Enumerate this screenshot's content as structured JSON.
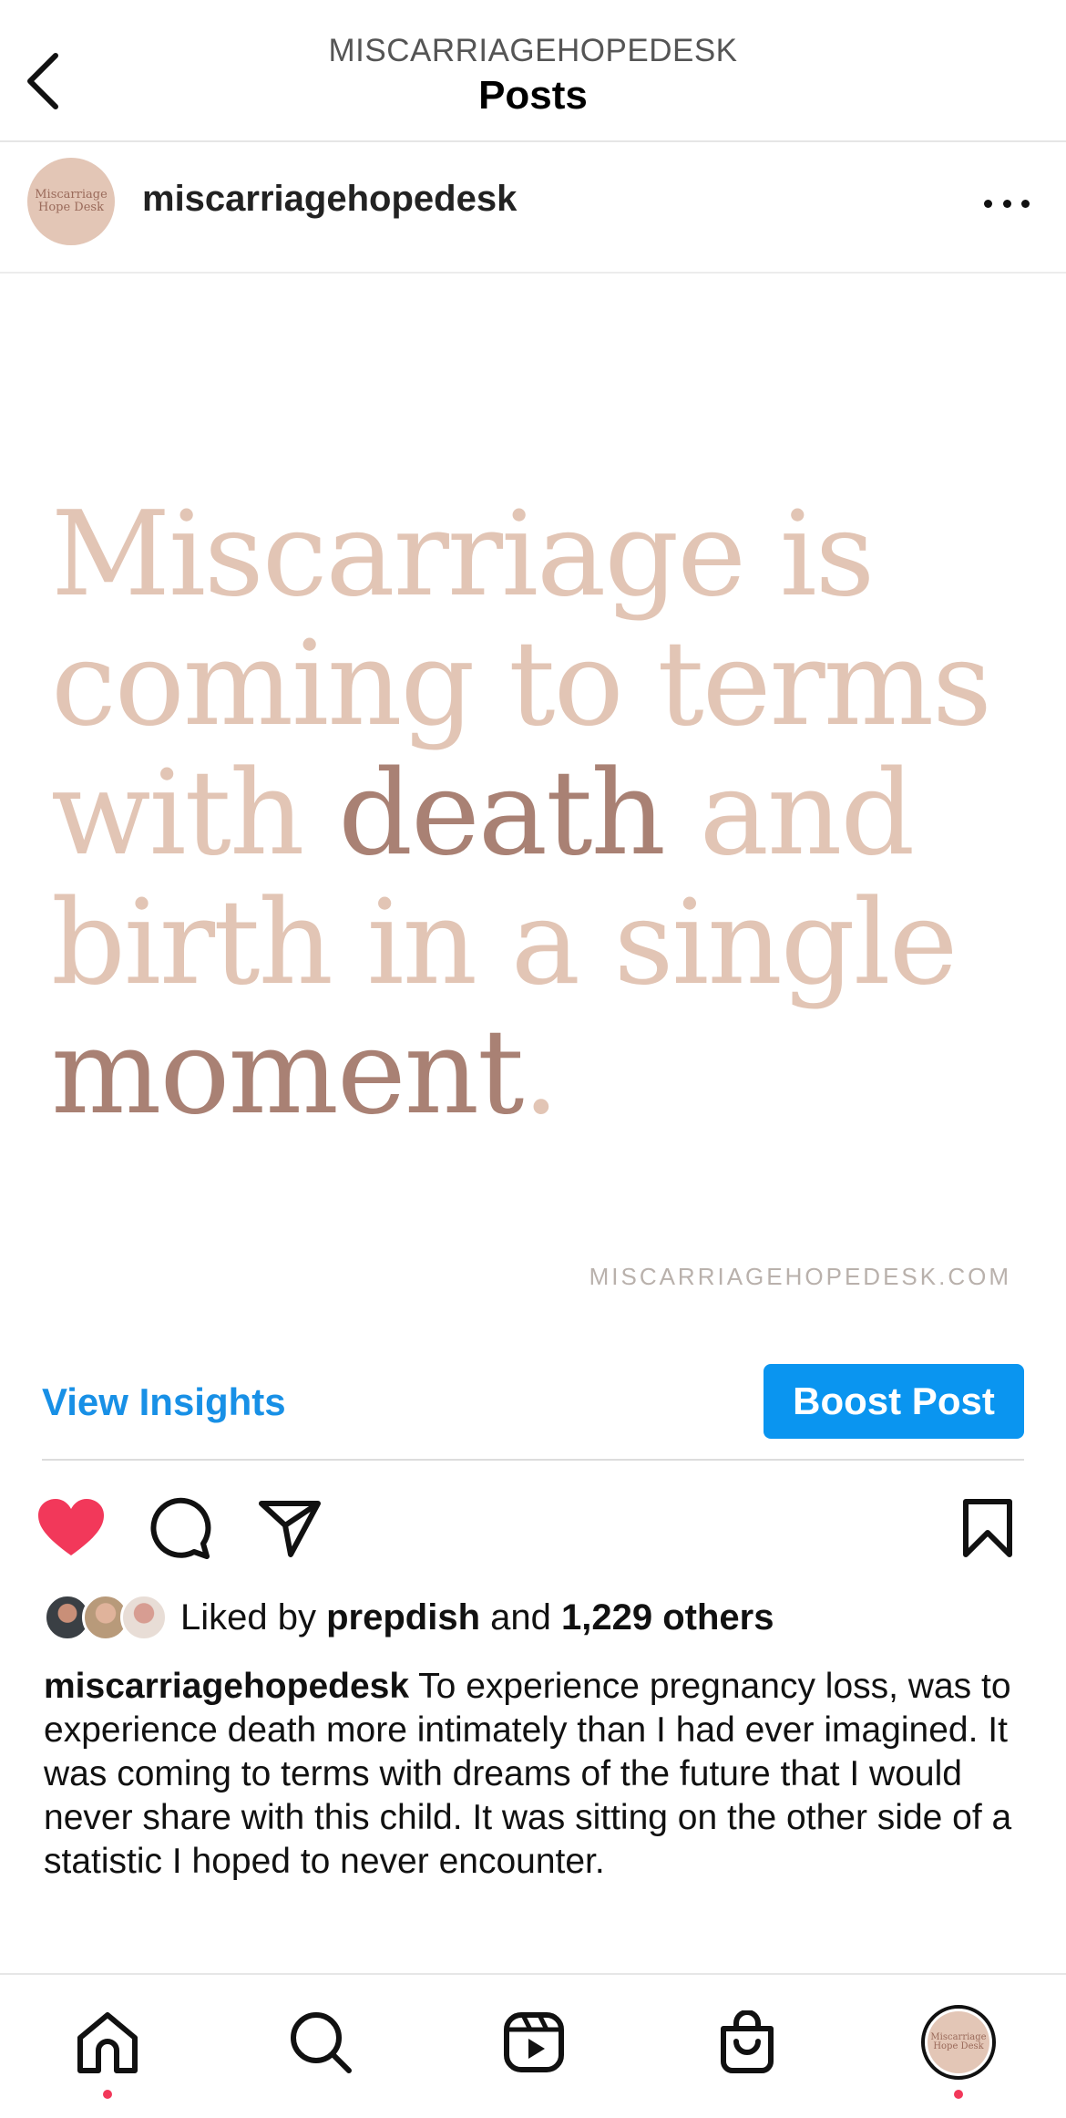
{
  "header": {
    "subtitle": "MISCARRIAGEHOPEDESK",
    "title": "Posts"
  },
  "author": {
    "username": "miscarriagehopedesk",
    "avatar_text": "Miscarriage Hope Desk"
  },
  "post_image": {
    "quote_lines": [
      [
        {
          "text": "Miscarriage is",
          "tone": "light"
        }
      ],
      [
        {
          "text": "coming to terms",
          "tone": "light"
        }
      ],
      [
        {
          "text": "with ",
          "tone": "light"
        },
        {
          "text": "death",
          "tone": "dark"
        },
        {
          "text": " and",
          "tone": "light"
        }
      ],
      [
        {
          "text": "birth in a single",
          "tone": "light"
        }
      ],
      [
        {
          "text": "moment",
          "tone": "dark"
        },
        {
          "text": ".",
          "tone": "light"
        }
      ]
    ],
    "site_url": "MISCARRIAGEHOPEDESK.COM",
    "colors": {
      "light": "#e2c5b5",
      "dark": "#a98174"
    }
  },
  "insights": {
    "view_label": "View Insights",
    "boost_label": "Boost Post"
  },
  "actions": {
    "icons": [
      "heart-icon",
      "comment-icon",
      "share-icon",
      "bookmark-icon"
    ],
    "liked": true
  },
  "likes": {
    "prefix": "Liked by ",
    "user": "prepdish",
    "middle": " and ",
    "count": "1,229 others"
  },
  "caption": {
    "username": "miscarriagehopedesk",
    "text": " To experience pregnancy loss, was to experience death more intimately than I had ever imagined. It was coming to terms with dreams of the future that I would never share with this child. It was sitting on the other side of a statistic I hoped to never encounter."
  },
  "bottom_nav": {
    "items": [
      "home-icon",
      "search-icon",
      "reels-icon",
      "shop-icon",
      "profile-avatar"
    ],
    "profile_avatar_text": "Miscarriage Hope Desk"
  },
  "accent_colors": {
    "like": "#f2385a",
    "link": "#1890e6",
    "boost": "#0a95f0"
  }
}
